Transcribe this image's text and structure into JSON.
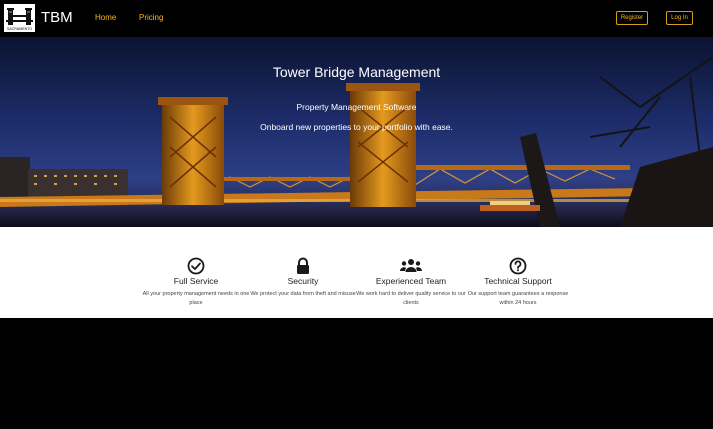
{
  "nav": {
    "brand": "TBM",
    "logo_caption": "SACRAMENTO",
    "links": [
      "Home",
      "Pricing"
    ],
    "register": "Register",
    "login": "Log In",
    "accent": "#f5b820"
  },
  "hero": {
    "title": "Tower Bridge Management",
    "subtitle": "Property Management Software",
    "tagline": "Onboard new properties to your portfolio with ease."
  },
  "features": [
    {
      "icon": "check-circle-icon",
      "title": "Full Service",
      "desc": "All your property management needs in one place"
    },
    {
      "icon": "lock-icon",
      "title": "Security",
      "desc": "We protect your data from theft and misuse"
    },
    {
      "icon": "users-icon",
      "title": "Experienced Team",
      "desc": "We work hard to deliver quality service to our clients"
    },
    {
      "icon": "question-circle-icon",
      "title": "Technical Support",
      "desc": "Our support team guarantees a response within 24 hours"
    }
  ]
}
